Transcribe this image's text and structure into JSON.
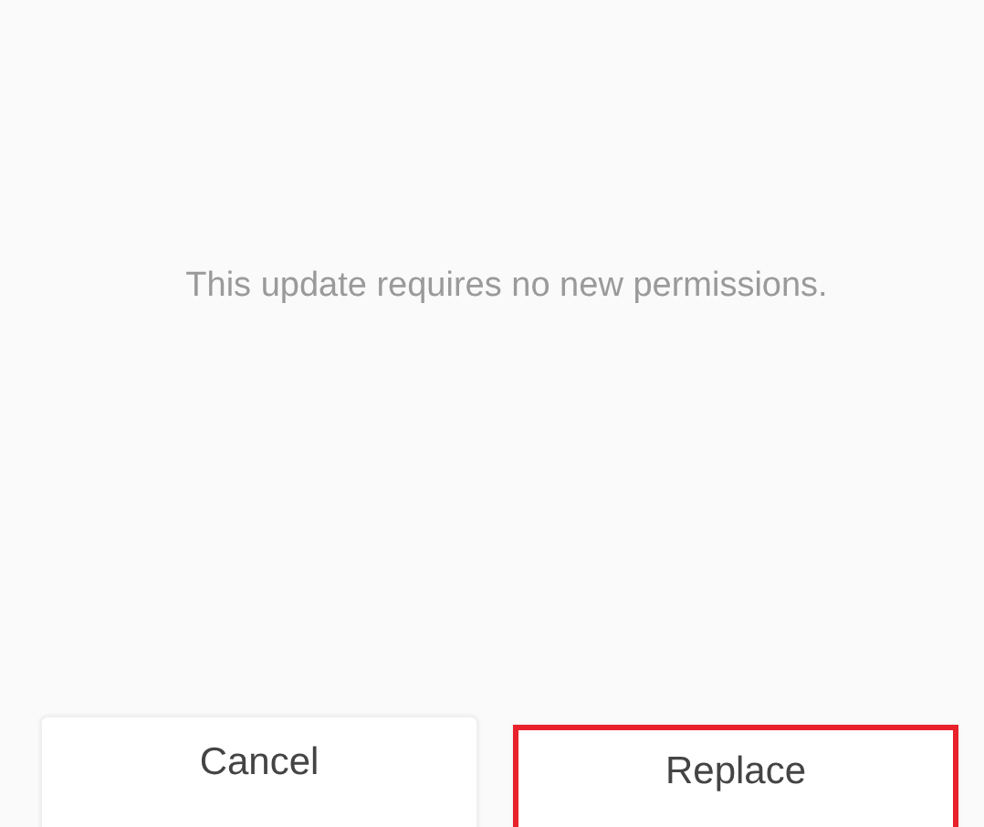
{
  "message": "This update requires no new permissions.",
  "buttons": [
    {
      "label": "Cancel",
      "highlighted": false
    },
    {
      "label": "Replace",
      "highlighted": true
    }
  ]
}
